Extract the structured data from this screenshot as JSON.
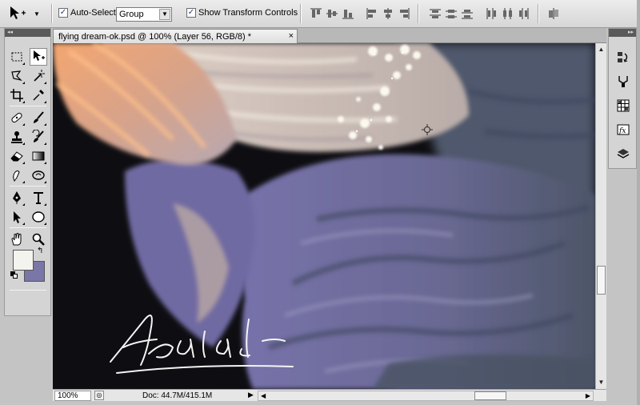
{
  "options_bar": {
    "auto_select_label": "Auto-Select:",
    "auto_select_checked": "✓",
    "group_value": "Group",
    "show_transform_label": "Show Transform Controls",
    "show_transform_checked": "✓",
    "move_tool_icon": "move-tool-icon"
  },
  "document": {
    "tab_title": "flying dream-ok.psd @ 100% (Layer 56, RGB/8) *",
    "close_glyph": "×"
  },
  "status_bar": {
    "zoom": "100%",
    "doc_info": "Doc: 44.7M/415.1M"
  },
  "toolbox": {
    "header_glyph": "◂◂",
    "tools": [
      "marquee",
      "move",
      "lasso",
      "magic-wand",
      "crop",
      "eyedropper",
      "healing-brush",
      "brush",
      "clone-stamp",
      "history-brush",
      "eraser",
      "gradient",
      "blur",
      "dodge",
      "pen",
      "type",
      "path-selection",
      "ellipse",
      "hand",
      "zoom"
    ],
    "foreground_color": "#f4f4ee",
    "background_color": "#7a76a8"
  },
  "dock": {
    "header_glyph": "▸▸",
    "buttons": [
      "history",
      "actions",
      "swatches",
      "styles",
      "layers"
    ]
  },
  "canvas": {
    "signature": "Algaladi-"
  },
  "colors": {
    "hair_orange": "#f3a670",
    "hair_cream": "#e8ddd2",
    "robe_lavender": "#7673a6",
    "robe_slate": "#4e5a6e"
  }
}
